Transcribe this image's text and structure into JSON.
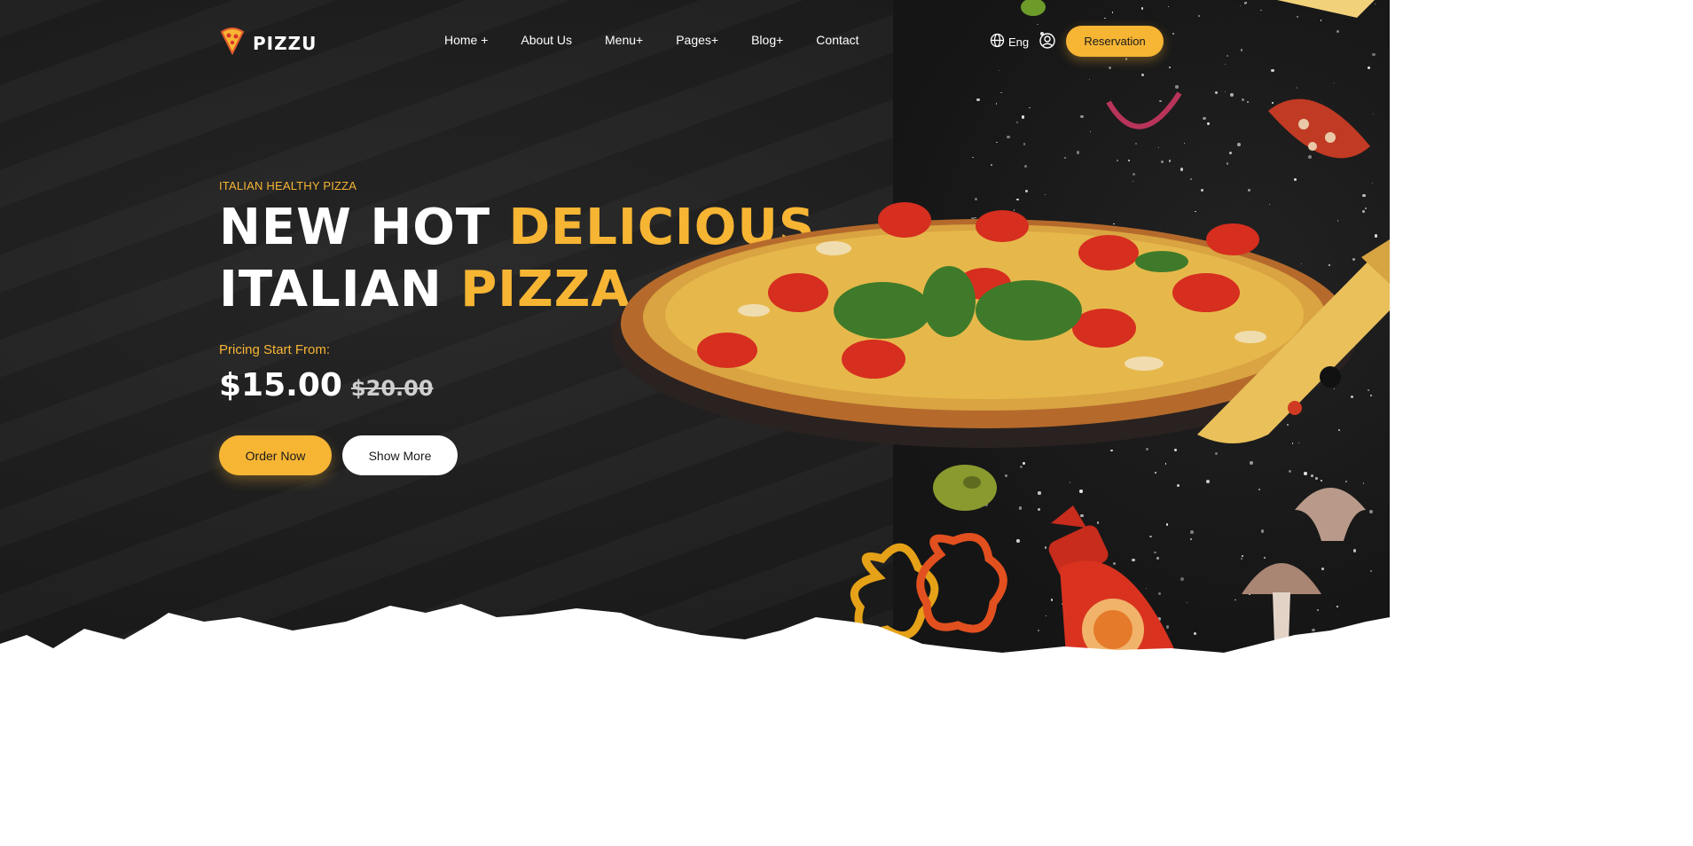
{
  "brand": {
    "name": "PIZZU",
    "logo_icon": "pizza-slice-icon"
  },
  "nav": {
    "items": [
      {
        "label": "Home +"
      },
      {
        "label": "About Us"
      },
      {
        "label": "Menu+"
      },
      {
        "label": "Pages+"
      },
      {
        "label": "Blog+"
      },
      {
        "label": "Contact"
      }
    ]
  },
  "header": {
    "language": "Eng",
    "language_icon": "globe-icon",
    "user_icon": "user-circle-icon",
    "reservation_label": "Reservation"
  },
  "hero": {
    "eyebrow": "ITALIAN HEALTHY PIZZA",
    "line1_white": "NEW HOT ",
    "line1_accent": "DELICIOUS",
    "line2_white": "ITALIAN ",
    "line2_accent": "PIZZA",
    "pricing_label": "Pricing Start From:",
    "price": "$15.00",
    "old_price": "$20.00",
    "order_label": "Order Now",
    "more_label": "Show More"
  },
  "colors": {
    "accent": "#f7b534",
    "background": "#1c1c1c",
    "text": "#ffffff"
  }
}
